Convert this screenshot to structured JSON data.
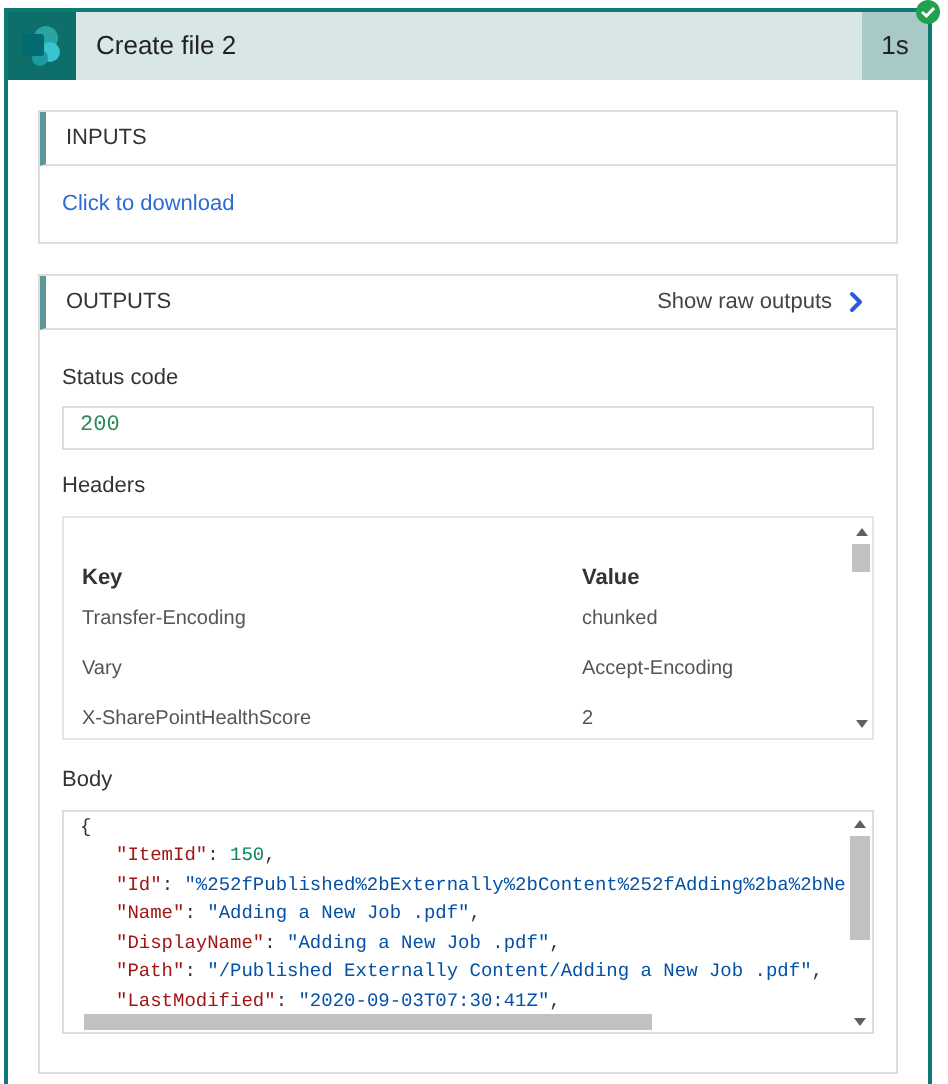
{
  "action": {
    "title": "Create file 2",
    "duration": "1s",
    "succeeded": true
  },
  "inputs": {
    "title": "INPUTS",
    "link": "Click to download"
  },
  "outputs": {
    "title": "OUTPUTS",
    "raw_link": "Show raw outputs",
    "status_label": "Status code",
    "status_value": "200",
    "headers_label": "Headers",
    "headers_columns": [
      "Key",
      "Value"
    ],
    "headers_rows": [
      {
        "key": "Transfer-Encoding",
        "value": "chunked"
      },
      {
        "key": "Vary",
        "value": "Accept-Encoding"
      },
      {
        "key": "X-SharePointHealthScore",
        "value": "2"
      }
    ],
    "body_label": "Body",
    "body_lines": [
      {
        "kind": "brace",
        "text": "{"
      },
      {
        "kind": "number",
        "key": "\"ItemId\"",
        "sep": ":",
        "value": "150",
        "tail": ","
      },
      {
        "kind": "string",
        "key": "\"Id\"",
        "sep": ":",
        "value": "\"%252fPublished%2bExternally%2bContent%252fAdding%2ba%2bNe"
      },
      {
        "kind": "string",
        "key": "\"Name\"",
        "sep": ":",
        "value": "\"Adding a New Job .pdf\"",
        "tail": ","
      },
      {
        "kind": "string",
        "key": "\"DisplayName\"",
        "sep": ":",
        "value": "\"Adding a New Job .pdf\"",
        "tail": ","
      },
      {
        "kind": "string",
        "key": "\"Path\"",
        "sep": ":",
        "value": "\"/Published Externally Content/Adding a New Job .pdf\"",
        "tail": ","
      },
      {
        "kind": "string",
        "key": "\"LastModified\"",
        "sep": ":",
        "value": "\"2020-09-03T07:30:41Z\"",
        "tail": ","
      }
    ]
  }
}
